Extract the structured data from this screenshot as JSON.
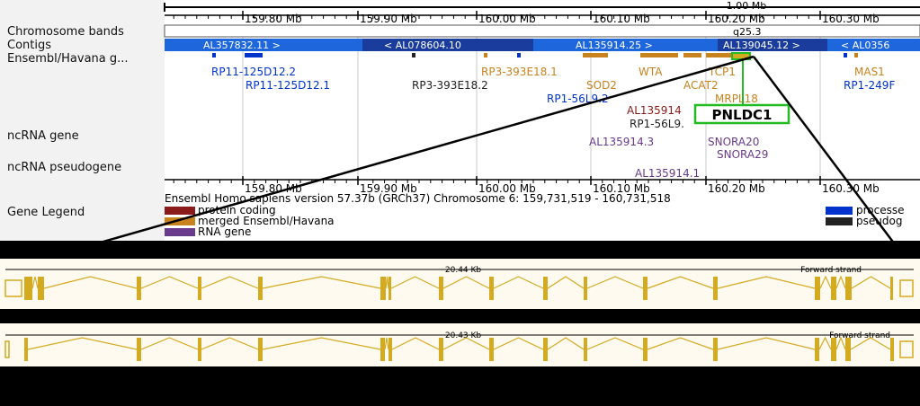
{
  "ruler": {
    "span_label": "1.00 Mb",
    "ticks": [
      "159.80 Mb",
      "159.90 Mb",
      "160.00 Mb",
      "160.10 Mb",
      "160.20 Mb",
      "160.30 Mb"
    ]
  },
  "tracks": {
    "chromosome_bands": "Chromosome bands",
    "band_label": "q25.3",
    "contigs": "Contigs",
    "ensembl": "Ensembl/Havana g...",
    "ncrna_gene": "ncRNA gene",
    "ncrna_pseudogene": "ncRNA pseudogene",
    "gene_legend": "Gene Legend"
  },
  "contigs": [
    "AL357832.11 >",
    "< AL078604.10",
    "AL135914.25 >",
    "AL139045.12 >",
    "< AL0356"
  ],
  "genes": {
    "rp11_125d12_2": "RP11-125D12.2",
    "rp11_125d12_1": "RP11-125D12.1",
    "rp3_393e18_2": "RP3-393E18.2",
    "rp3_393e18_1": "RP3-393E18.1",
    "sod2": "SOD2",
    "wtap": "WTA",
    "tcp1": "TCP1",
    "agat2": "ACAT2",
    "mrpl18": "MRPL18",
    "rp1_56l9_2": "RP1-56L9.2",
    "al135914_red": "AL135914",
    "rp1_56l9_1": "RP1-56L9.",
    "al135914_3": "AL135914.3",
    "snora20": "SNORA20",
    "snora29": "SNORA29",
    "al135914_1": "AL135914.1",
    "mas1": "MAS1",
    "rp1_249f": "RP1-249F"
  },
  "highlight_gene": "PNLDC1",
  "footer": {
    "version": "Ensembl Homo sapiens version 57.37b (GRCh37) Chromosome 6: 159,731,519 - 160,731,518"
  },
  "legend": {
    "protein_coding": "protein coding",
    "merged": "merged Ensembl/Havana",
    "rna_gene": "RNA gene",
    "processed": "processe",
    "pseudogene": "pseudog"
  },
  "transcript1": {
    "length": "20.44 Kb",
    "strand": "Forward strand"
  },
  "transcript2": {
    "length": "20.43 Kb",
    "strand": "Forward strand"
  },
  "colors": {
    "contig_dark": "#1a3c9c",
    "contig_light": "#1e66dc",
    "protein_coding": "#8b1a1a",
    "merged": "#c8821e",
    "rna_gene": "#6a3b8c",
    "processed": "#0033cc",
    "pseudogene": "#222222",
    "highlight": "#22bb22",
    "exon": "#d4aa20",
    "panel_bg": "#fffaf0"
  }
}
